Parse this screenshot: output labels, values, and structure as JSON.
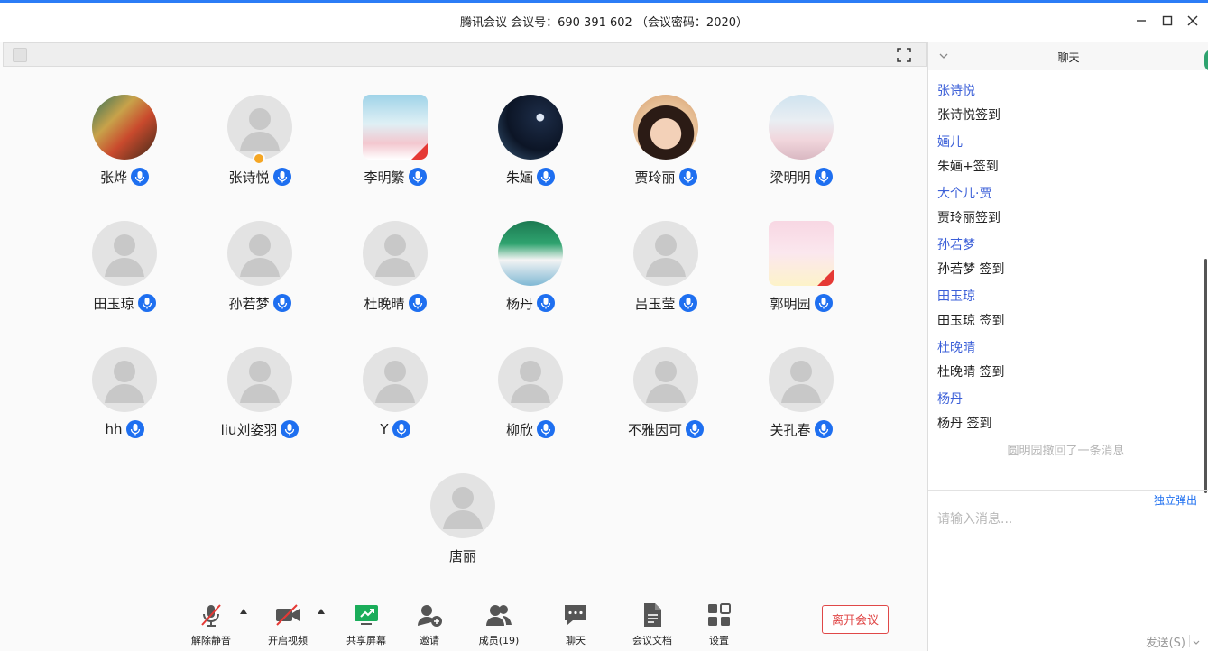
{
  "window": {
    "title": "腾讯会议 会议号：690 391 602 （会议密码：2020）"
  },
  "participants": [
    {
      "name": "张烨",
      "avatar": "photo-1",
      "mic": "on",
      "flag": false,
      "host": false
    },
    {
      "name": "张诗悦",
      "avatar": "default",
      "mic": "on",
      "flag": false,
      "host": true
    },
    {
      "name": "李明繁",
      "avatar": "photo-2",
      "mic": "on",
      "flag": true,
      "host": false
    },
    {
      "name": "朱婳",
      "avatar": "photo-3",
      "mic": "on",
      "flag": false,
      "host": false
    },
    {
      "name": "贾玲丽",
      "avatar": "photo-4",
      "mic": "on",
      "flag": false,
      "host": false
    },
    {
      "name": "梁明明",
      "avatar": "photo-5",
      "mic": "on",
      "flag": false,
      "host": false
    },
    {
      "name": "田玉琼",
      "avatar": "default",
      "mic": "on",
      "flag": false,
      "host": false
    },
    {
      "name": "孙若梦",
      "avatar": "default",
      "mic": "on",
      "flag": false,
      "host": false
    },
    {
      "name": "杜晚晴",
      "avatar": "default",
      "mic": "on",
      "flag": false,
      "host": false
    },
    {
      "name": "杨丹",
      "avatar": "photo-6",
      "mic": "on",
      "flag": false,
      "host": false
    },
    {
      "name": "吕玉莹",
      "avatar": "default",
      "mic": "on",
      "flag": false,
      "host": false
    },
    {
      "name": "郭明园",
      "avatar": "photo-7",
      "mic": "on",
      "flag": true,
      "host": false
    },
    {
      "name": "hh",
      "avatar": "default",
      "mic": "on",
      "flag": false,
      "host": false
    },
    {
      "name": "liu刘姿羽",
      "avatar": "default",
      "mic": "on",
      "flag": false,
      "host": false
    },
    {
      "name": "Y",
      "avatar": "default",
      "mic": "on",
      "flag": false,
      "host": false
    },
    {
      "name": "柳欣",
      "avatar": "default",
      "mic": "on",
      "flag": false,
      "host": false
    },
    {
      "name": "不雅因可",
      "avatar": "default",
      "mic": "on",
      "flag": false,
      "host": false
    },
    {
      "name": "关孔春",
      "avatar": "default",
      "mic": "on",
      "flag": false,
      "host": false
    },
    {
      "name": "唐丽",
      "avatar": "default",
      "mic": "none",
      "flag": false,
      "host": false
    }
  ],
  "toolbar": {
    "unmute_label": "解除静音",
    "video_label": "开启视频",
    "share_label": "共享屏幕",
    "invite_label": "邀请",
    "members_label": "成员(19)",
    "chat_label": "聊天",
    "docs_label": "会议文档",
    "settings_label": "设置",
    "leave_label": "离开会议",
    "accent": "#1e6ff0",
    "leave_color": "#e04848",
    "share_color": "#1aad5a"
  },
  "chat": {
    "title": "聊天",
    "messages": [
      {
        "sender": "张诗悦",
        "content": "张诗悦签到"
      },
      {
        "sender": "婳儿",
        "content": "朱婳+签到"
      },
      {
        "sender": "大个儿·贾",
        "content": "贾玲丽签到"
      },
      {
        "sender": "孙若梦",
        "content": "孙若梦 签到"
      },
      {
        "sender": "田玉琼",
        "content": "田玉琼 签到"
      },
      {
        "sender": "杜晚晴",
        "content": "杜晚晴 签到"
      },
      {
        "sender": "杨丹",
        "content": "杨丹  签到"
      }
    ],
    "recall_notice": "圆明园撤回了一条消息",
    "popout_label": "独立弹出",
    "input_placeholder": "请输入消息...",
    "send_label": "发送(S)",
    "sender_color": "#3b5fd8"
  }
}
